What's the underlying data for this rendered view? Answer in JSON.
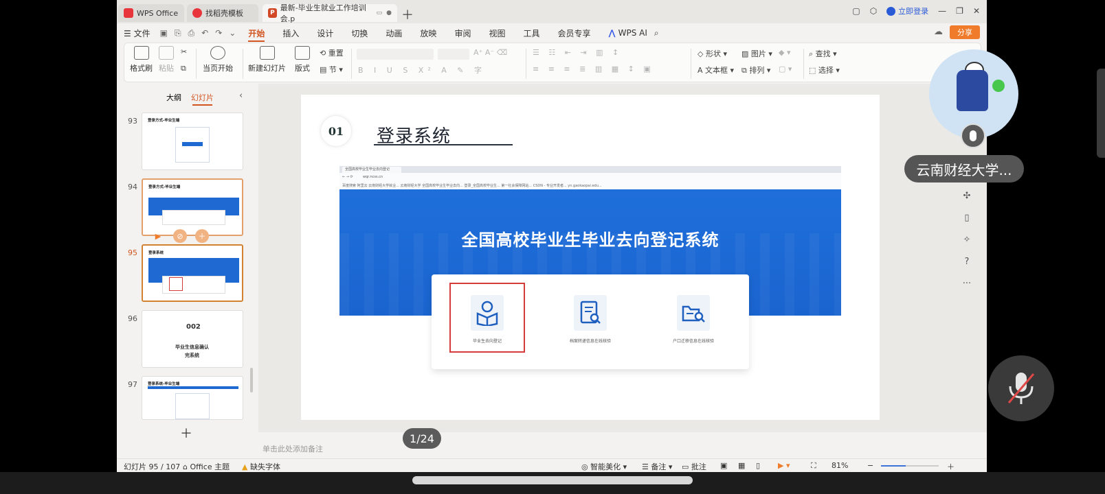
{
  "titlebar": {
    "tabs": [
      {
        "label": "WPS Office"
      },
      {
        "label": "找稻壳模板"
      },
      {
        "label": "最新-毕业生就业工作培训会.p"
      }
    ],
    "login_label": "立即登录"
  },
  "menubar": {
    "file_label": "文件",
    "items": [
      "开始",
      "插入",
      "设计",
      "切换",
      "动画",
      "放映",
      "审阅",
      "视图",
      "工具",
      "会员专享"
    ],
    "active": "开始",
    "wps_ai_label": "WPS AI",
    "share_label": "分享"
  },
  "ribbon": {
    "format_painter": "格式刷",
    "paste": "粘贴",
    "play_from_current": "当页开始",
    "new_slide": "新建幻灯片",
    "layout": "版式",
    "section": "节",
    "reset": "重置",
    "shape": "形状",
    "picture": "图片",
    "textbox": "文本框",
    "arrange": "排列",
    "find": "查找",
    "select": "选择"
  },
  "left_panel": {
    "tab_outline": "大纲",
    "tab_slides": "幻灯片",
    "active_tab": "幻灯片",
    "thumbnails": [
      {
        "num": "93",
        "title": "登录方式-毕业生端"
      },
      {
        "num": "94",
        "title": "登录方式-毕业生端"
      },
      {
        "num": "95",
        "title": "登录系统"
      },
      {
        "num": "96",
        "title": "毕业生信息确认",
        "number": "002",
        "subtitle": "毕业生信息确认",
        "subtitle2": "完系统"
      },
      {
        "num": "97",
        "title": "登录系统-毕业生端"
      }
    ],
    "current": "95"
  },
  "slide": {
    "number": "01",
    "title": "登录系统",
    "browser": {
      "tab_label": "全国高校毕业生毕业去向登记",
      "url": "wqr.ncss.cn",
      "bookmarks": "百度搜索   阿里云   云南财经大学就业...   云南财经大学   全国高校毕业生毕业去向...   登录_全国高校毕业生...   第一社会保障网站...   CSDN - 专业开发者...   yn.gaokaopai.edu...",
      "hero_title": "全国高校毕业生毕业去向登记系统",
      "options": [
        {
          "label": "毕业生去向登记",
          "icon": "person-book-icon"
        },
        {
          "label": "档案转递信息在线核验",
          "icon": "document-search-icon"
        },
        {
          "label": "户口迁移信息在线核验",
          "icon": "folder-search-icon"
        }
      ]
    }
  },
  "notes_placeholder": "单击此处添加备注",
  "page_indicator": "1/24",
  "statusbar": {
    "slide_info": "幻灯片 95 / 107",
    "theme": "Office 主题",
    "missing_font": "缺失字体",
    "smart_beautify": "智能美化",
    "notes": "备注",
    "comments": "批注",
    "zoom": "81%"
  },
  "overlay": {
    "participant_name": "云南财经大学..."
  },
  "colors": {
    "accent": "#d2541f",
    "share": "#f07b2a",
    "hero_blue": "#1f6fdb",
    "highlight_red": "#d63b3b"
  }
}
